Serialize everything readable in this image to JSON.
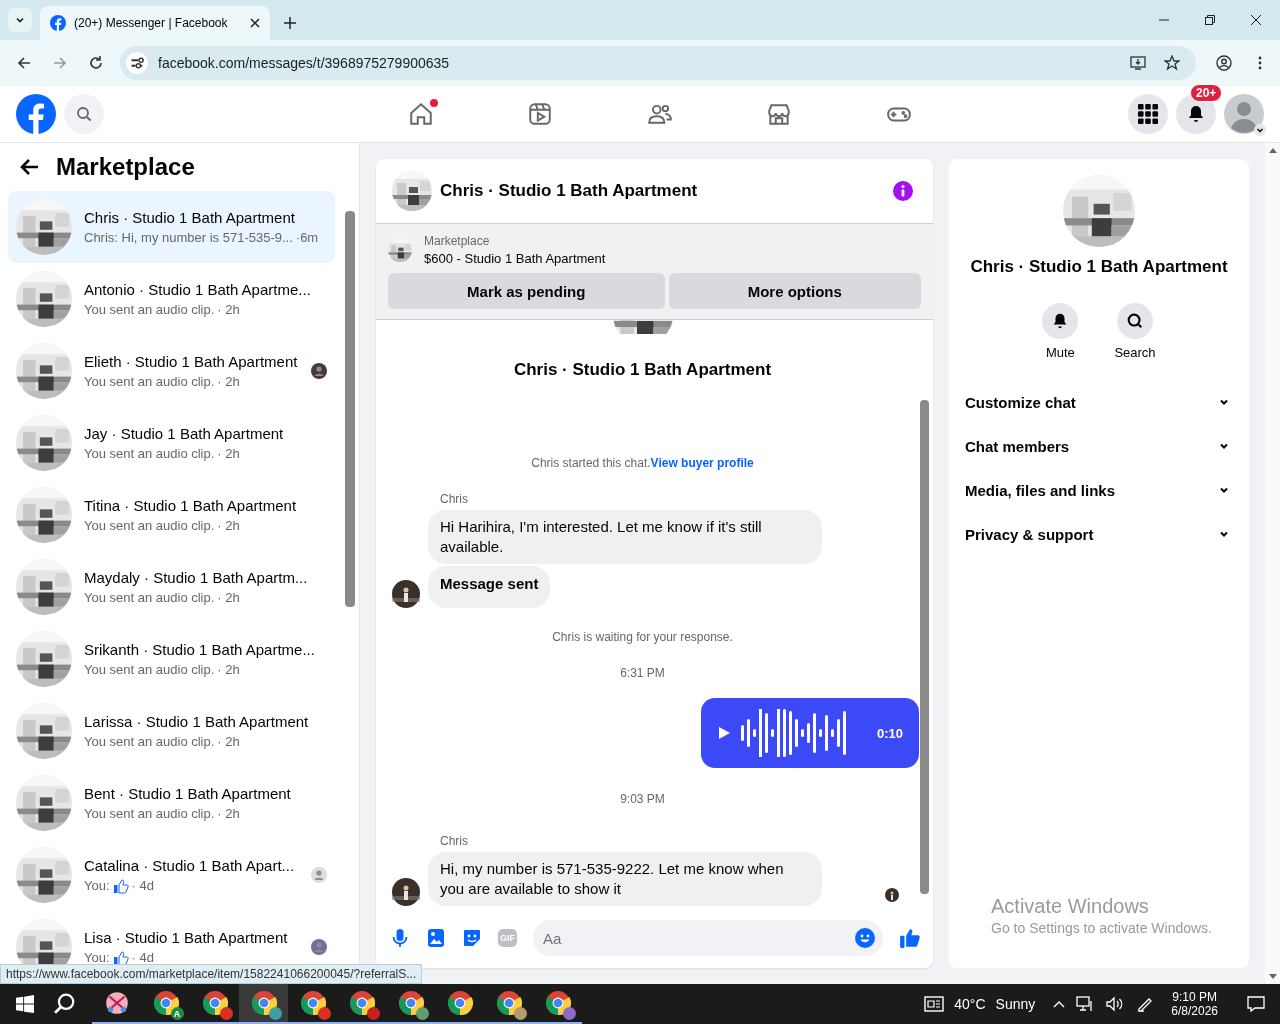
{
  "browser": {
    "tab_title": "(20+) Messenger | Facebook",
    "url": "facebook.com/messages/t/3968975279900635"
  },
  "nav": {
    "tabs": [
      {
        "kind": "home",
        "selected": false,
        "dot": true
      },
      {
        "kind": "video",
        "selected": false,
        "dot": false
      },
      {
        "kind": "friends",
        "selected": false,
        "dot": false
      },
      {
        "kind": "store",
        "selected": false,
        "dot": false
      },
      {
        "kind": "game",
        "selected": false,
        "dot": false
      }
    ],
    "notifications_badge": "20+"
  },
  "sidebar": {
    "title": "Marketplace",
    "items": [
      {
        "name": "Chris · Studio 1 Bath Apartment",
        "kind": "text",
        "preview": "Chris: Hi, my number is 571-535-9...",
        "time": "·6m",
        "selected": true,
        "seen": false
      },
      {
        "name": "Antonio · Studio 1 Bath Apartme...",
        "kind": "text",
        "preview": "You sent an audio clip.",
        "time": "· 2h",
        "selected": false,
        "seen": false
      },
      {
        "name": "Elieth · Studio 1 Bath Apartment",
        "kind": "text",
        "preview": "You sent an audio clip.",
        "time": "· 2h",
        "selected": false,
        "seen": true,
        "color": "#4a3a32"
      },
      {
        "name": "Jay · Studio 1 Bath Apartment",
        "kind": "text",
        "preview": "You sent an audio clip.",
        "time": "· 2h",
        "selected": false,
        "seen": false
      },
      {
        "name": "Titina · Studio 1 Bath Apartment",
        "kind": "text",
        "preview": "You sent an audio clip.",
        "time": "· 2h",
        "selected": false,
        "seen": false
      },
      {
        "name": "Maydaly · Studio 1 Bath Apartm...",
        "kind": "text",
        "preview": "You sent an audio clip.",
        "time": "· 2h",
        "selected": false,
        "seen": false
      },
      {
        "name": "Srikanth · Studio 1 Bath Apartme...",
        "kind": "text",
        "preview": "You sent an audio clip.",
        "time": "· 2h",
        "selected": false,
        "seen": false
      },
      {
        "name": "Larissa · Studio 1 Bath Apartment",
        "kind": "text",
        "preview": "You sent an audio clip.",
        "time": "· 2h",
        "selected": false,
        "seen": false
      },
      {
        "name": "Bent · Studio 1 Bath Apartment",
        "kind": "text",
        "preview": "You sent an audio clip.",
        "time": "· 2h",
        "selected": false,
        "seen": false
      },
      {
        "name": "Catalina · Studio 1 Bath Apart...",
        "kind": "like",
        "preview": "You:",
        "time": "· 4d",
        "selected": false,
        "seen": true,
        "color": "#dadde1"
      },
      {
        "name": "Lisa · Studio 1 Bath Apartment",
        "kind": "like",
        "preview": "You:",
        "time": "· 4d",
        "selected": false,
        "seen": true,
        "color": "#7b6a9c"
      }
    ]
  },
  "status_url": "https://www.facebook.com/marketplace/item/1582241066200045/?referralS...",
  "chat": {
    "title": "Chris · Studio 1 Bath Apartment",
    "listing": {
      "label": "Marketplace",
      "title": "$600 - Studio 1 Bath Apartment",
      "buttons": [
        "Mark as pending",
        "More options"
      ]
    },
    "intro_name": "Chris · Studio 1 Bath Apartment",
    "messages": [
      {
        "kind": "system",
        "text": "Chris started this chat.",
        "link": "View buyer profile"
      },
      {
        "kind": "incoming",
        "sender": "Chris",
        "text": "Hi Harihira, I'm interested. Let me know if it's still available.",
        "avatar": false,
        "bold": false
      },
      {
        "kind": "incoming",
        "text": "Message sent",
        "avatar": true,
        "bold": true
      },
      {
        "kind": "system",
        "text": "Chris is waiting for your response."
      },
      {
        "kind": "time",
        "text": "6:31 PM"
      },
      {
        "kind": "audio",
        "duration": "0:10"
      },
      {
        "kind": "time",
        "text": "9:03 PM"
      },
      {
        "kind": "incoming",
        "sender": "Chris",
        "text": "Hi, my number is 571-535-9222. Let me know when you are available to show it",
        "avatar": true,
        "bold": false
      }
    ],
    "composer": {
      "gif_label": "GIF",
      "placeholder": "Aa"
    }
  },
  "details": {
    "name": "Chris · Studio 1 Bath Apartment",
    "actions": [
      {
        "kind": "bell",
        "label": "Mute"
      },
      {
        "kind": "search",
        "label": "Search"
      }
    ],
    "sections": [
      {
        "label": "Customize chat",
        "expanded": false
      },
      {
        "label": "Chat members",
        "expanded": false
      },
      {
        "label": "Media, files and links",
        "expanded": false
      },
      {
        "label": "Privacy & support",
        "expanded": false
      }
    ]
  },
  "activation": {
    "title": "Activate Windows",
    "subtitle": "Go to Settings to activate Windows."
  },
  "taskbar": {
    "apps": [
      {
        "kind": "snip",
        "selected": false
      },
      {
        "kind": "chrome",
        "color": "#1e8e3e",
        "letter": "A",
        "selected": false
      },
      {
        "kind": "chrome",
        "color": "#d93025",
        "selected": false
      },
      {
        "kind": "chrome",
        "color": "#3f9ea0",
        "selected": true
      },
      {
        "kind": "chrome",
        "color": "#d93025",
        "selected": false
      },
      {
        "kind": "chrome",
        "color": "#c5221f",
        "selected": false
      },
      {
        "kind": "chrome",
        "color": "#5f9e6e",
        "selected": false
      },
      {
        "kind": "chrome",
        "selected": false
      },
      {
        "kind": "chrome",
        "color": "#b59a6a",
        "selected": false
      },
      {
        "kind": "chrome",
        "color": "#8e6bc9",
        "selected": false
      }
    ],
    "temperature": "40°C",
    "weather": "Sunny",
    "time": "9:10 PM",
    "date": "6/8/2026"
  }
}
